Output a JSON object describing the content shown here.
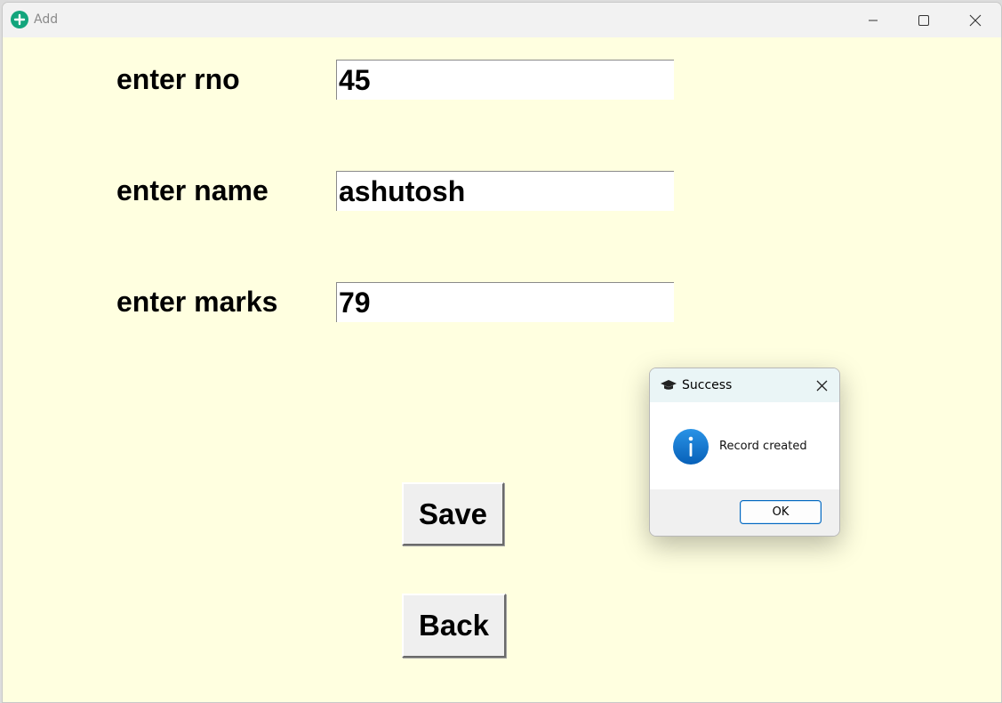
{
  "window": {
    "title": "Add",
    "icon": "add-circle-icon"
  },
  "form": {
    "rno": {
      "label": "enter rno",
      "value": "45"
    },
    "name": {
      "label": "enter name",
      "value": "ashutosh"
    },
    "marks": {
      "label": "enter marks",
      "value": "79"
    }
  },
  "buttons": {
    "save_label": "Save",
    "back_label": "Back"
  },
  "dialog": {
    "title": "Success",
    "title_icon": "graduation-cap-icon",
    "message": "Record created",
    "message_icon": "info-icon",
    "ok_label": "OK"
  },
  "colors": {
    "background": "#ffffe0",
    "app_icon": "#13a57c",
    "info_icon": "#0a72c9",
    "ok_border": "#0067c0"
  }
}
